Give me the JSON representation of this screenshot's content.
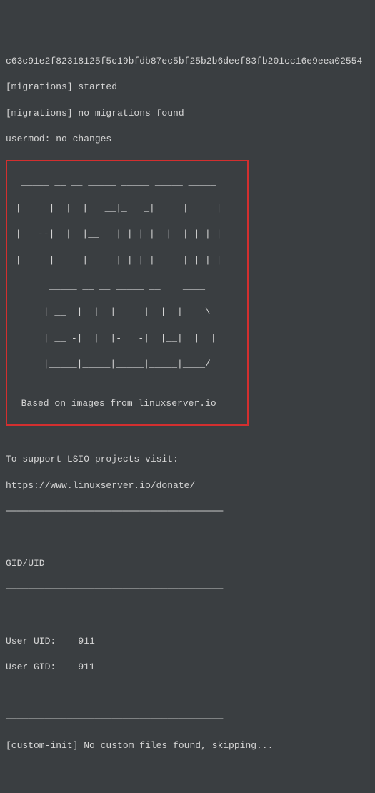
{
  "log": {
    "hash": "c63c91e2f82318125f5c19bfdb87ec5bf25b2b6deef83fb201cc16e9eea02554",
    "migrations_started": "[migrations] started",
    "migrations_none": "[migrations] no migrations found",
    "usermod": "usermod: no changes"
  },
  "banner": {
    "l1": "  _____ __ __ _____ _____ _____ _____   ",
    "l2": " |     |  |  |   __|_   _|     |     |  ",
    "l3": " |   --|  |  |__   | | | |  |  | | | |  ",
    "l4": " |_____|_____|_____| |_| |_____|_|_|_|  ",
    "l5": "       _____ __ __ _____ __    ____     ",
    "l6": "      | __  |  |  |     |  |  |    \\    ",
    "l7": "      | __ -|  |  |-   -|  |__|  |  |   ",
    "l8": "      |_____|_____|_____|_____|____/    ",
    "l9": "",
    "l10": "  Based on images from linuxserver.io  "
  },
  "support": {
    "line1": "To support LSIO projects visit:",
    "url": "https://www.linuxserver.io/donate/"
  },
  "divider": "───────────────────────────────────────",
  "gid_uid": {
    "header": "GID/UID",
    "uid_label": "User UID:    911",
    "gid_label": "User GID:    911"
  },
  "custom_init": "[custom-init] No custom files found, skipping..."
}
